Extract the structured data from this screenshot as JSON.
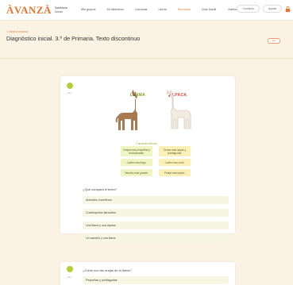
{
  "header": {
    "logo": "ÀVANZÀ",
    "logo_sub": "Santil­lana Lector",
    "nav": [
      {
        "label": "Mis grupos"
      },
      {
        "label": "Mi biblioteca"
      },
      {
        "label": "Licencias"
      },
      {
        "label": "Libros"
      },
      {
        "label": "Recursos"
      },
      {
        "label": "Club Santil."
      },
      {
        "label": "Administrar"
      }
    ],
    "contact_label": "Contacto",
    "help_label": "Ayuda"
  },
  "page": {
    "breadcrumb": "< Volver a recursos",
    "title": "Diagnóstico inicial. 3.º de Primaria. Texto discontinuo",
    "pill_label": "Ver"
  },
  "item1": {
    "number_label": "Ítem",
    "llama_label": "LLAMA",
    "alpaca_label": "ALPACA",
    "characteristics_title": "Características",
    "rows": [
      {
        "left": "Orejas más pequeñas y redondeadas.",
        "right": "Orejas más largas y puntiagudas."
      },
      {
        "left": "Cuello más largo.",
        "right": "Cuello más corto."
      },
      {
        "left": "Tamaño más grande.",
        "right": "Pelaje más tupido."
      }
    ],
    "question": "¿Qué compara el texto?",
    "options": [
      "Animales mamíferos",
      "Cuadrúpedos Ilarcuidos",
      "Una llama y una alpaca",
      "Un camello y una llama"
    ]
  },
  "item2": {
    "number_label": "Ítem",
    "question": "¿Cómo son las orejas de la llama?",
    "first_option": "Pequeñas y puntiagudas"
  },
  "colors": {
    "brand": "#e8742c",
    "badge": "#b6cc3a",
    "llama": "#7da218",
    "alpaca": "#e0463c"
  }
}
